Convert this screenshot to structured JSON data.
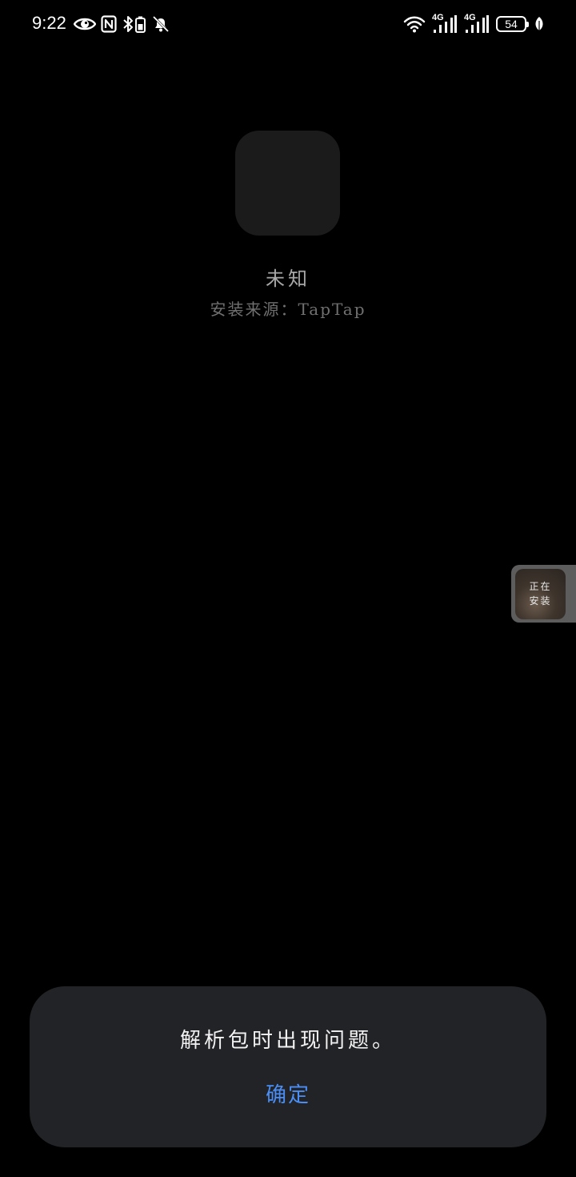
{
  "status_bar": {
    "time": "9:22",
    "left_icons": [
      "eye-icon",
      "nfc-icon",
      "bluetooth-battery-icon",
      "bell-off-icon"
    ],
    "right_icons": [
      "wifi-icon",
      "signal-4g-icon",
      "signal-4g-icon",
      "battery-icon",
      "leaf-icon"
    ],
    "network_label_1": "4G",
    "network_label_2": "4G",
    "battery_level": "54"
  },
  "app": {
    "name": "未知",
    "install_source": "安装来源：TapTap"
  },
  "floating_bubble": {
    "line1": "正在",
    "line2": "安装"
  },
  "dialog": {
    "message": "解析包时出现问题。",
    "confirm_label": "确定"
  },
  "colors": {
    "background": "#000000",
    "dialog_background": "#222326",
    "accent": "#4a8ef5"
  }
}
